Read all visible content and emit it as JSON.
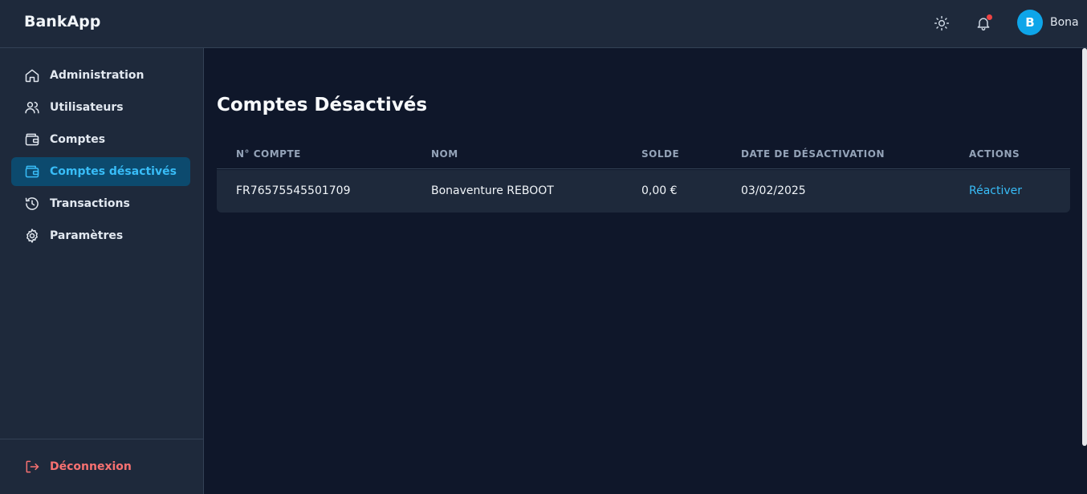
{
  "app": {
    "brand": "BankApp"
  },
  "header": {
    "user_initial": "B",
    "user_name": "Bona",
    "notification_dot_color": "#ef4444",
    "avatar_color": "#0ea5e9"
  },
  "sidebar": {
    "items": [
      {
        "label": "Administration",
        "icon": "home-icon"
      },
      {
        "label": "Utilisateurs",
        "icon": "users-icon"
      },
      {
        "label": "Comptes",
        "icon": "wallet-icon"
      },
      {
        "label": "Comptes désactivés",
        "icon": "wallet-icon",
        "active": true
      },
      {
        "label": "Transactions",
        "icon": "history-icon"
      },
      {
        "label": "Paramètres",
        "icon": "gear-icon"
      }
    ],
    "logout_label": "Déconnexion"
  },
  "main": {
    "title": "Comptes Désactivés",
    "columns": [
      "N° COMPTE",
      "NOM",
      "SOLDE",
      "DATE DE DÉSACTIVATION",
      "ACTIONS"
    ],
    "rows": [
      {
        "account": "FR76575545501709",
        "name": "Bonaventure REBOOT",
        "balance": "0,00 €",
        "date": "03/02/2025",
        "action": "Réactiver"
      }
    ]
  },
  "colors": {
    "accent": "#38bdf8",
    "danger": "#f87171",
    "active_bg": "#0c4a6e"
  }
}
